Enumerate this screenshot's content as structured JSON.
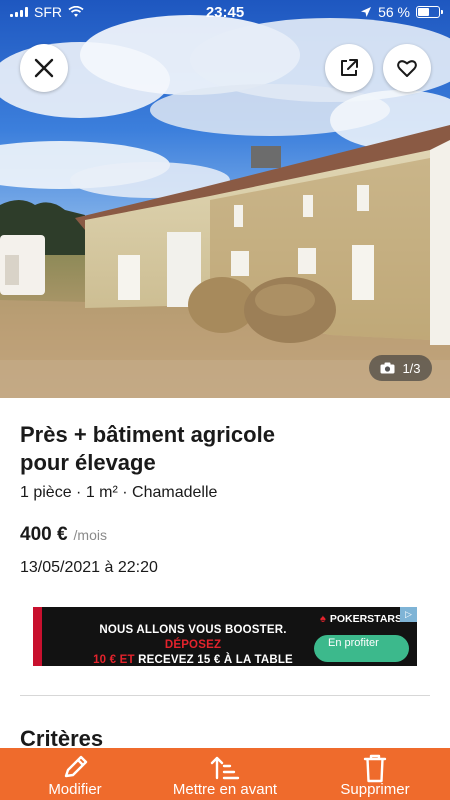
{
  "status_bar": {
    "carrier": "SFR",
    "time": "23:45",
    "battery": "56 %",
    "battery_level": 0.56
  },
  "photo": {
    "counter": "1/3",
    "current": 1,
    "total": 3
  },
  "listing": {
    "title": "Près + bâtiment agricole pour élevage",
    "meta": "1 pièce · 1 m² · Chamadelle",
    "price": "400 €",
    "price_unit": "/mois",
    "date": "13/05/2021 à 22:20"
  },
  "ad": {
    "line1_white": "NOUS ALLONS VOUS BOOSTER.",
    "line1_red": "DÉPOSEZ",
    "line2_red": "10 € ET",
    "line2_white": "RECEVEZ 15 € À LA TABLE",
    "brand": "POKERSTARS",
    "cta": "En profiter",
    "info_icon": "▷",
    "colors": {
      "cta": "#3cb98c",
      "red": "#e3232c"
    }
  },
  "section": {
    "criteres": "Critères"
  },
  "actions": {
    "modify": "Modifier",
    "promote": "Mettre en avant",
    "delete": "Supprimer"
  },
  "colors": {
    "accent": "#ef6b2c",
    "sky": "#2f6fd0"
  },
  "icons": [
    "close-icon",
    "share-icon",
    "heart-icon",
    "camera-icon",
    "pencil-icon",
    "sort-up-icon",
    "trash-icon"
  ]
}
